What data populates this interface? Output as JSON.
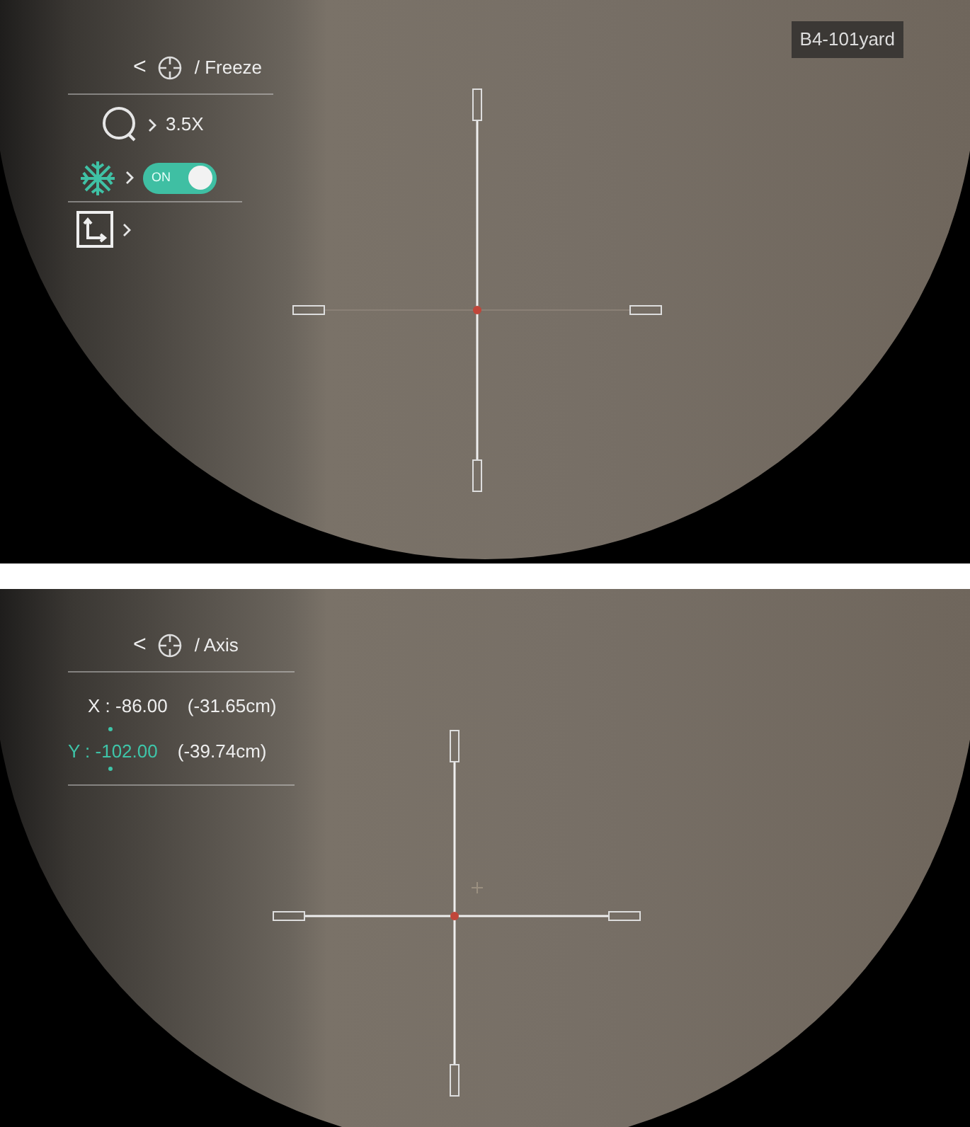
{
  "screens": [
    {
      "kind": "freeze",
      "back": "<",
      "breadcrumb": "/ Freeze",
      "distance_label": "B4-101yard",
      "menu": [
        {
          "kind": "zoom",
          "value": "3.5X"
        },
        {
          "kind": "freeze",
          "toggle": {
            "label": "ON",
            "on": true
          }
        },
        {
          "kind": "axis"
        }
      ]
    },
    {
      "kind": "axis",
      "back": "<",
      "breadcrumb": "/ Axis",
      "coords": [
        {
          "label": "X :",
          "value": "-86.00",
          "offset": "(-31.65cm)",
          "selected": false
        },
        {
          "label": "Y :",
          "value": "-102.00",
          "offset": "(-39.74cm)",
          "selected": true
        }
      ]
    }
  ]
}
